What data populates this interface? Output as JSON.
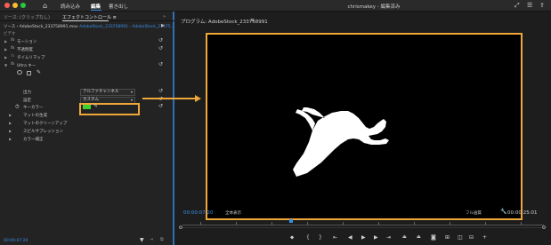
{
  "titlebar": {
    "nav": [
      "読み込み",
      "編集",
      "書き出し"
    ],
    "active_nav": "編集",
    "window_title": "chrismakey - 編集済み",
    "colors": {
      "close": "#ff5f57",
      "minimize": "#febc2e",
      "maximize": "#28c840"
    }
  },
  "left_panel": {
    "tabs": [
      "ソース: (クリップなし)",
      "エフェクトコントロール ≡"
    ],
    "source_name": "ソース・AdobeStock_233758991.mov",
    "source_clip": "AdobeStock_233758991 - AdobeStock_23375...",
    "section_video": "ビデオ",
    "effects": [
      {
        "fx": "fx",
        "label": "モーション"
      },
      {
        "fx": "fx",
        "label": "不透明度"
      },
      {
        "fx": "fx",
        "label": "タイムリマップ"
      },
      {
        "fx": "fx",
        "label": "Ultra キー"
      }
    ],
    "output_label": "出力",
    "output_value": "アルファチャンネル",
    "setting_label": "設定",
    "setting_value": "カスタム",
    "keycolor_label": "キーカラー",
    "subs": [
      "マットの生成",
      "マットのクリーンアップ",
      "スピルサプレッション",
      "カラー補正"
    ],
    "timecode": "00:00:07:20",
    "keycolor_swatch": "#3cd12e"
  },
  "program": {
    "title": "プログラム: AdobeStock_233758991",
    "timecode_current": "00:00:07:20",
    "zoom": "全体表示",
    "quality": "フル画質",
    "timecode_duration": "00:00:25:01",
    "accent": "#f0a73a",
    "playhead_color": "#3a8ee6"
  }
}
